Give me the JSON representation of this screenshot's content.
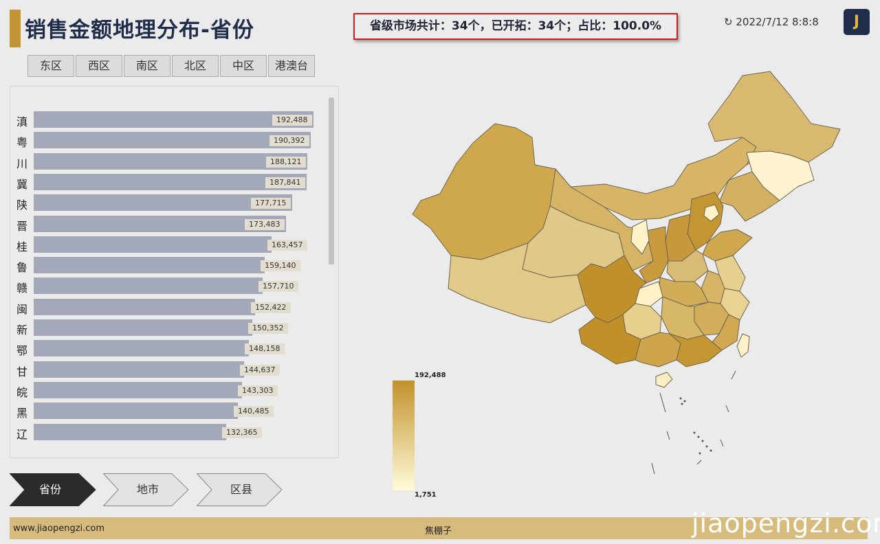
{
  "header": {
    "title": "销售金额地理分布-省份",
    "summary": "省级市场共计：34个，已开拓：34个；占比：100.0%",
    "refresh_icon": "refresh-icon",
    "datetime": "2022/7/12 8:8:8",
    "logo_letter": "J"
  },
  "region_tabs": [
    "东区",
    "西区",
    "南区",
    "北区",
    "中区",
    "港澳台"
  ],
  "ranking": [
    {
      "label": "滇",
      "value": 192488,
      "display": "192,488"
    },
    {
      "label": "粤",
      "value": 190392,
      "display": "190,392"
    },
    {
      "label": "川",
      "value": 188121,
      "display": "188,121"
    },
    {
      "label": "冀",
      "value": 187841,
      "display": "187,841"
    },
    {
      "label": "陕",
      "value": 177715,
      "display": "177,715"
    },
    {
      "label": "晋",
      "value": 173483,
      "display": "173,483"
    },
    {
      "label": "桂",
      "value": 163457,
      "display": "163,457"
    },
    {
      "label": "鲁",
      "value": 159140,
      "display": "159,140"
    },
    {
      "label": "赣",
      "value": 157710,
      "display": "157,710"
    },
    {
      "label": "闽",
      "value": 152422,
      "display": "152,422"
    },
    {
      "label": "新",
      "value": 150352,
      "display": "150,352"
    },
    {
      "label": "鄂",
      "value": 148158,
      "display": "148,158"
    },
    {
      "label": "甘",
      "value": 144637,
      "display": "144,637"
    },
    {
      "label": "皖",
      "value": 143303,
      "display": "143,303"
    },
    {
      "label": "黑",
      "value": 140485,
      "display": "140,485"
    },
    {
      "label": "辽",
      "value": 132365,
      "display": "132,365"
    }
  ],
  "level_nav": [
    {
      "label": "省份",
      "active": true
    },
    {
      "label": "地市",
      "active": false
    },
    {
      "label": "区县",
      "active": false
    }
  ],
  "legend": {
    "max": "192,488",
    "min": "1,751",
    "max_color": "#c2922b",
    "min_color": "#fffbd9"
  },
  "footer": {
    "url": "www.jiaopengzi.com",
    "author": "焦棚子"
  },
  "watermark": "jiaopengzi.com",
  "colors": {
    "accent": "#c39433",
    "bar": "#a4a9ba",
    "highlight_border": "#d21c1c",
    "navy": "#1f2d4b"
  }
}
